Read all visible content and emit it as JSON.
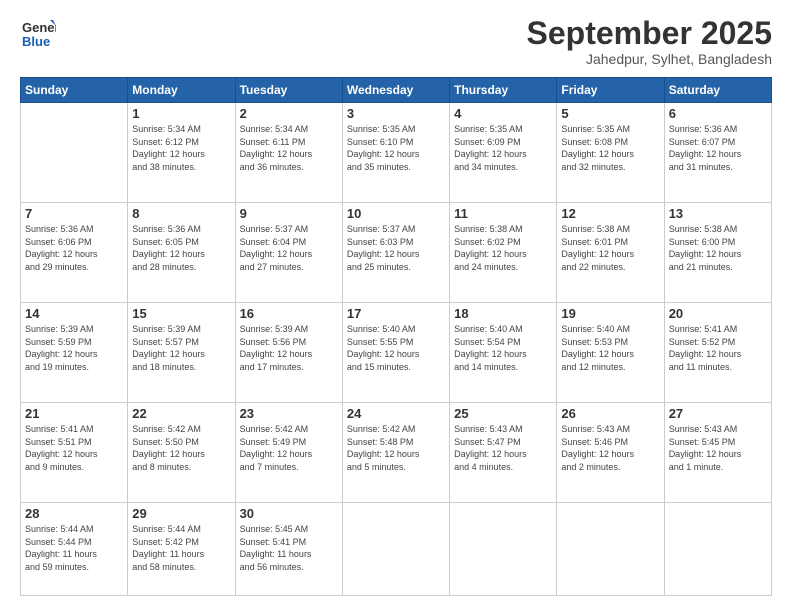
{
  "logo": {
    "line1": "General",
    "line2": "Blue"
  },
  "title": "September 2025",
  "location": "Jahedpur, Sylhet, Bangladesh",
  "weekdays": [
    "Sunday",
    "Monday",
    "Tuesday",
    "Wednesday",
    "Thursday",
    "Friday",
    "Saturday"
  ],
  "weeks": [
    [
      {
        "day": "",
        "info": ""
      },
      {
        "day": "1",
        "info": "Sunrise: 5:34 AM\nSunset: 6:12 PM\nDaylight: 12 hours\nand 38 minutes."
      },
      {
        "day": "2",
        "info": "Sunrise: 5:34 AM\nSunset: 6:11 PM\nDaylight: 12 hours\nand 36 minutes."
      },
      {
        "day": "3",
        "info": "Sunrise: 5:35 AM\nSunset: 6:10 PM\nDaylight: 12 hours\nand 35 minutes."
      },
      {
        "day": "4",
        "info": "Sunrise: 5:35 AM\nSunset: 6:09 PM\nDaylight: 12 hours\nand 34 minutes."
      },
      {
        "day": "5",
        "info": "Sunrise: 5:35 AM\nSunset: 6:08 PM\nDaylight: 12 hours\nand 32 minutes."
      },
      {
        "day": "6",
        "info": "Sunrise: 5:36 AM\nSunset: 6:07 PM\nDaylight: 12 hours\nand 31 minutes."
      }
    ],
    [
      {
        "day": "7",
        "info": "Sunrise: 5:36 AM\nSunset: 6:06 PM\nDaylight: 12 hours\nand 29 minutes."
      },
      {
        "day": "8",
        "info": "Sunrise: 5:36 AM\nSunset: 6:05 PM\nDaylight: 12 hours\nand 28 minutes."
      },
      {
        "day": "9",
        "info": "Sunrise: 5:37 AM\nSunset: 6:04 PM\nDaylight: 12 hours\nand 27 minutes."
      },
      {
        "day": "10",
        "info": "Sunrise: 5:37 AM\nSunset: 6:03 PM\nDaylight: 12 hours\nand 25 minutes."
      },
      {
        "day": "11",
        "info": "Sunrise: 5:38 AM\nSunset: 6:02 PM\nDaylight: 12 hours\nand 24 minutes."
      },
      {
        "day": "12",
        "info": "Sunrise: 5:38 AM\nSunset: 6:01 PM\nDaylight: 12 hours\nand 22 minutes."
      },
      {
        "day": "13",
        "info": "Sunrise: 5:38 AM\nSunset: 6:00 PM\nDaylight: 12 hours\nand 21 minutes."
      }
    ],
    [
      {
        "day": "14",
        "info": "Sunrise: 5:39 AM\nSunset: 5:59 PM\nDaylight: 12 hours\nand 19 minutes."
      },
      {
        "day": "15",
        "info": "Sunrise: 5:39 AM\nSunset: 5:57 PM\nDaylight: 12 hours\nand 18 minutes."
      },
      {
        "day": "16",
        "info": "Sunrise: 5:39 AM\nSunset: 5:56 PM\nDaylight: 12 hours\nand 17 minutes."
      },
      {
        "day": "17",
        "info": "Sunrise: 5:40 AM\nSunset: 5:55 PM\nDaylight: 12 hours\nand 15 minutes."
      },
      {
        "day": "18",
        "info": "Sunrise: 5:40 AM\nSunset: 5:54 PM\nDaylight: 12 hours\nand 14 minutes."
      },
      {
        "day": "19",
        "info": "Sunrise: 5:40 AM\nSunset: 5:53 PM\nDaylight: 12 hours\nand 12 minutes."
      },
      {
        "day": "20",
        "info": "Sunrise: 5:41 AM\nSunset: 5:52 PM\nDaylight: 12 hours\nand 11 minutes."
      }
    ],
    [
      {
        "day": "21",
        "info": "Sunrise: 5:41 AM\nSunset: 5:51 PM\nDaylight: 12 hours\nand 9 minutes."
      },
      {
        "day": "22",
        "info": "Sunrise: 5:42 AM\nSunset: 5:50 PM\nDaylight: 12 hours\nand 8 minutes."
      },
      {
        "day": "23",
        "info": "Sunrise: 5:42 AM\nSunset: 5:49 PM\nDaylight: 12 hours\nand 7 minutes."
      },
      {
        "day": "24",
        "info": "Sunrise: 5:42 AM\nSunset: 5:48 PM\nDaylight: 12 hours\nand 5 minutes."
      },
      {
        "day": "25",
        "info": "Sunrise: 5:43 AM\nSunset: 5:47 PM\nDaylight: 12 hours\nand 4 minutes."
      },
      {
        "day": "26",
        "info": "Sunrise: 5:43 AM\nSunset: 5:46 PM\nDaylight: 12 hours\nand 2 minutes."
      },
      {
        "day": "27",
        "info": "Sunrise: 5:43 AM\nSunset: 5:45 PM\nDaylight: 12 hours\nand 1 minute."
      }
    ],
    [
      {
        "day": "28",
        "info": "Sunrise: 5:44 AM\nSunset: 5:44 PM\nDaylight: 11 hours\nand 59 minutes."
      },
      {
        "day": "29",
        "info": "Sunrise: 5:44 AM\nSunset: 5:42 PM\nDaylight: 11 hours\nand 58 minutes."
      },
      {
        "day": "30",
        "info": "Sunrise: 5:45 AM\nSunset: 5:41 PM\nDaylight: 11 hours\nand 56 minutes."
      },
      {
        "day": "",
        "info": ""
      },
      {
        "day": "",
        "info": ""
      },
      {
        "day": "",
        "info": ""
      },
      {
        "day": "",
        "info": ""
      }
    ]
  ]
}
